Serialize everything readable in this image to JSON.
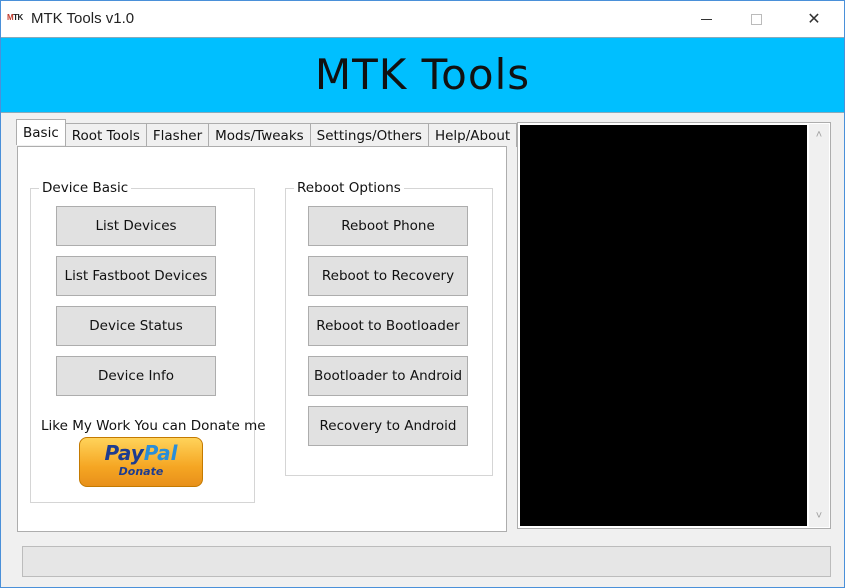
{
  "window": {
    "title": "MTK Tools v1.0",
    "icon_label_m": "M",
    "icon_label_tk": "TK",
    "controls": [
      "minimize-icon",
      "maximize-icon",
      "close-icon"
    ],
    "close_glyph": "✕"
  },
  "banner": {
    "title": "MTK Tools",
    "color": "#00bfff"
  },
  "tabs": [
    {
      "label": "Basic",
      "active": true
    },
    {
      "label": "Root Tools",
      "active": false
    },
    {
      "label": "Flasher",
      "active": false
    },
    {
      "label": "Mods/Tweaks",
      "active": false
    },
    {
      "label": "Settings/Others",
      "active": false
    },
    {
      "label": "Help/About",
      "active": false
    }
  ],
  "device_basic": {
    "label": "Device Basic",
    "buttons": [
      "List Devices",
      "List Fastboot Devices",
      "Device Status",
      "Device Info"
    ],
    "donate_text": "Like My Work You can Donate me",
    "paypal": {
      "pay": "Pay",
      "pal": "Pal",
      "sub": "Donate"
    }
  },
  "reboot_options": {
    "label": "Reboot Options",
    "buttons": [
      "Reboot Phone",
      "Reboot to Recovery",
      "Reboot to Bootloader",
      "Bootloader to Android",
      "Recovery to Android"
    ]
  },
  "console": {
    "background": "#000000",
    "scroll_up_glyph": "˄",
    "scroll_down_glyph": "˅"
  },
  "progress": {
    "value": 0
  }
}
